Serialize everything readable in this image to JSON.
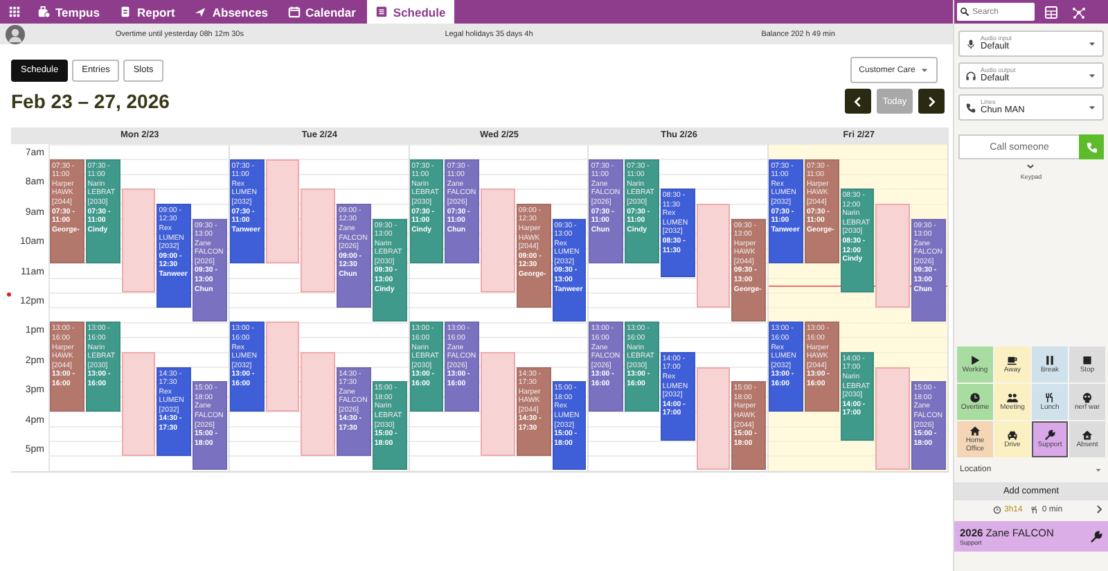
{
  "nav": {
    "tabs": [
      {
        "label": "Tempus",
        "kind": "bag",
        "selected": false
      },
      {
        "label": "Report",
        "kind": "report",
        "selected": false
      },
      {
        "label": "Absences",
        "kind": "plane",
        "selected": false
      },
      {
        "label": "Calendar",
        "kind": "calendar",
        "selected": false
      },
      {
        "label": "Schedule",
        "kind": "list",
        "selected": true
      }
    ]
  },
  "info_bar": [
    "Overtime until yesterday 08h 12m 30s",
    "Legal holidays 35 days 4h",
    "Balance 202 h 49 min"
  ],
  "view_tabs": [
    {
      "label": "Schedule",
      "selected": true
    },
    {
      "label": "Entries",
      "selected": false
    },
    {
      "label": "Slots",
      "selected": false
    }
  ],
  "team_select": {
    "value": "Customer Care"
  },
  "title": "Feb 23 – 27, 2026",
  "today_button": {
    "label": "Today",
    "disabled": true
  },
  "hours": [
    "7am",
    "8am",
    "9am",
    "10am",
    "11am",
    "12pm",
    "1pm",
    "2pm",
    "3pm",
    "4pm",
    "5pm"
  ],
  "days": [
    {
      "label": "Mon 2/23",
      "today": false,
      "events": [
        {
          "kind": "shift",
          "time": "07:30 - 11:00",
          "person": "Harper HAWK [2044]",
          "color": "#b3776c",
          "extra_time": "07:30 - 11:00",
          "extra_name": "George-"
        },
        {
          "kind": "shift",
          "time": "07:30 - 11:00",
          "person": "Narin LEBRAT [2030]",
          "color": "#3f9a8b",
          "extra_time": "07:30 - 11:00",
          "extra_name": "Cindy"
        },
        {
          "kind": "slot"
        },
        {
          "kind": "shift",
          "time": "09:00 - 12:30",
          "person": "Rex LUMEN [2032]",
          "color": "#3f5fd8",
          "extra_time": "09:00 - 12:30",
          "extra_name": "Tanweer"
        },
        {
          "kind": "shift",
          "time": "09:30 - 13:00",
          "person": "Zane FALCON [2026]",
          "color": "#7a72c0",
          "extra_time": "09:30 - 13:00",
          "extra_name": "Chun"
        },
        {
          "kind": "shift",
          "time": "13:00 - 16:00",
          "person": "Harper HAWK [2044]",
          "color": "#b3776c",
          "extra_time": "13:00 - 16:00"
        },
        {
          "kind": "shift",
          "time": "13:00 - 16:00",
          "person": "Narin LEBRAT [2030]",
          "color": "#3f9a8b",
          "extra_time": "13:00 - 16:00"
        },
        {
          "kind": "slot"
        },
        {
          "kind": "shift",
          "time": "14:30 - 17:30",
          "person": "Rex LUMEN [2032]",
          "color": "#3f5fd8",
          "extra_time": "14:30 - 17:30"
        },
        {
          "kind": "shift",
          "time": "15:00 - 18:00",
          "person": "Zane FALCON [2026]",
          "color": "#7a72c0",
          "extra_time": "15:00 - 18:00"
        }
      ]
    },
    {
      "label": "Tue 2/24",
      "today": false,
      "events": [
        {
          "kind": "shift",
          "time": "07:30 - 11:00",
          "person": "Rex LUMEN [2032]",
          "color": "#3f5fd8",
          "extra_time": "07:30 - 11:00",
          "extra_name": "Tanweer"
        },
        {
          "kind": "mirror_slot"
        },
        {
          "kind": "slot"
        },
        {
          "kind": "shift",
          "time": "09:00 - 12:30",
          "person": "Zane FALCON [2026]",
          "color": "#7a72c0",
          "extra_time": "09:00 - 12:30",
          "extra_name": "Chun"
        },
        {
          "kind": "shift",
          "time": "09:30 - 13:00",
          "person": "Narin LEBRAT [2030]",
          "color": "#3f9a8b",
          "extra_time": "09:30 - 13:00",
          "extra_name": "Cindy"
        },
        {
          "kind": "shift",
          "time": "13:00 - 16:00",
          "person": "Rex LUMEN [2032]",
          "color": "#3f5fd8",
          "extra_time": "13:00 - 16:00"
        },
        {
          "kind": "mirror_slot"
        },
        {
          "kind": "slot"
        },
        {
          "kind": "shift",
          "time": "14:30 - 17:30",
          "person": "Zane FALCON [2026]",
          "color": "#7a72c0",
          "extra_time": "14:30 - 17:30"
        },
        {
          "kind": "shift",
          "time": "15:00 - 18:00",
          "person": "Narin LEBRAT [2030]",
          "color": "#3f9a8b",
          "extra_time": "15:00 - 18:00"
        }
      ]
    },
    {
      "label": "Wed 2/25",
      "today": false,
      "events": [
        {
          "kind": "shift",
          "time": "07:30 - 11:00",
          "person": "Narin LEBRAT [2030]",
          "color": "#3f9a8b",
          "extra_time": "07:30 - 11:00",
          "extra_name": "Cindy"
        },
        {
          "kind": "shift",
          "time": "07:30 - 11:00",
          "person": "Zane FALCON [2026]",
          "color": "#7a72c0",
          "extra_time": "07:30 - 11:00",
          "extra_name": "Chun"
        },
        {
          "kind": "slot"
        },
        {
          "kind": "shift",
          "time": "09:00 - 12:30",
          "person": "Harper HAWK [2044]",
          "color": "#b3776c",
          "extra_time": "09:00 - 12:30",
          "extra_name": "George-"
        },
        {
          "kind": "shift",
          "time": "09:30 - 13:00",
          "person": "Rex LUMEN [2032]",
          "color": "#3f5fd8",
          "extra_time": "09:30 - 13:00",
          "extra_name": "Tanweer"
        },
        {
          "kind": "shift",
          "time": "13:00 - 16:00",
          "person": "Narin LEBRAT [2030]",
          "color": "#3f9a8b",
          "extra_time": "13:00 - 16:00"
        },
        {
          "kind": "shift",
          "time": "13:00 - 16:00",
          "person": "Zane FALCON [2026]",
          "color": "#7a72c0",
          "extra_time": "13:00 - 16:00"
        },
        {
          "kind": "slot"
        },
        {
          "kind": "shift",
          "time": "14:30 - 17:30",
          "person": "Harper HAWK [2044]",
          "color": "#b3776c",
          "extra_time": "14:30 - 17:30"
        },
        {
          "kind": "shift",
          "time": "15:00 - 18:00",
          "person": "Rex LUMEN [2032]",
          "color": "#3f5fd8",
          "extra_time": "15:00 - 18:00"
        }
      ]
    },
    {
      "label": "Thu 2/26",
      "today": false,
      "events": [
        {
          "kind": "shift",
          "time": "07:30 - 11:00",
          "person": "Zane FALCON [2026]",
          "color": "#7a72c0",
          "extra_time": "07:30 - 11:00",
          "extra_name": "Chun"
        },
        {
          "kind": "shift",
          "time": "07:30 - 11:00",
          "person": "Narin LEBRAT [2030]",
          "color": "#3f9a8b",
          "extra_time": "07:30 - 11:00",
          "extra_name": "Cindy"
        },
        {
          "kind": "shift",
          "time": "08:30 - 11:30",
          "person": "Rex LUMEN [2032]",
          "color": "#3f5fd8",
          "extra_time": "08:30 - 11:30"
        },
        {
          "kind": "slot"
        },
        {
          "kind": "shift",
          "time": "09:30 - 13:00",
          "person": "Harper HAWK [2044]",
          "color": "#b3776c",
          "extra_time": "09:30 - 13:00",
          "extra_name": "George-"
        },
        {
          "kind": "shift",
          "time": "13:00 - 16:00",
          "person": "Zane FALCON [2026]",
          "color": "#7a72c0",
          "extra_time": "13:00 - 16:00"
        },
        {
          "kind": "shift",
          "time": "13:00 - 16:00",
          "person": "Narin LEBRAT [2030]",
          "color": "#3f9a8b",
          "extra_time": "13:00 - 16:00"
        },
        {
          "kind": "shift",
          "time": "14:00 - 17:00",
          "person": "Rex LUMEN [2032]",
          "color": "#3f5fd8",
          "extra_time": "14:00 - 17:00"
        },
        {
          "kind": "slot"
        },
        {
          "kind": "shift",
          "time": "15:00 - 18:00",
          "person": "Harper HAWK [2044]",
          "color": "#b3776c",
          "extra_time": "15:00 - 18:00"
        }
      ]
    },
    {
      "label": "Fri 2/27",
      "today": true,
      "events": [
        {
          "kind": "shift",
          "time": "07:30 - 11:00",
          "person": "Rex LUMEN [2032]",
          "color": "#3f5fd8",
          "extra_time": "07:30 - 11:00",
          "extra_name": "Tanweer"
        },
        {
          "kind": "shift",
          "time": "07:30 - 11:00",
          "person": "Harper HAWK [2044]",
          "color": "#b3776c",
          "extra_time": "07:30 - 11:00",
          "extra_name": "George-"
        },
        {
          "kind": "shift",
          "time": "08:30 - 12:00",
          "person": "Narin LEBRAT [2030]",
          "color": "#3f9a8b",
          "extra_time": "08:30 - 12:00",
          "extra_name": "Cindy"
        },
        {
          "kind": "slot"
        },
        {
          "kind": "shift",
          "time": "09:30 - 13:00",
          "person": "Zane FALCON [2026]",
          "color": "#7a72c0",
          "extra_time": "09:30 - 13:00",
          "extra_name": "Chun"
        },
        {
          "kind": "shift",
          "time": "13:00 - 16:00",
          "person": "Rex LUMEN [2032]",
          "color": "#3f5fd8",
          "extra_time": "13:00 - 16:00"
        },
        {
          "kind": "shift",
          "time": "13:00 - 16:00",
          "person": "Harper HAWK [2044]",
          "color": "#b3776c",
          "extra_time": "13:00 - 16:00"
        },
        {
          "kind": "shift",
          "time": "14:00 - 17:00",
          "person": "Narin LEBRAT [2030]",
          "color": "#3f9a8b",
          "extra_time": "14:00 - 17:00"
        },
        {
          "kind": "slot"
        },
        {
          "kind": "shift",
          "time": "15:00 - 18:00",
          "person": "Zane FALCON [2026]",
          "color": "#7a72c0",
          "extra_time": "15:00 - 18:00"
        }
      ]
    }
  ],
  "sidebar": {
    "search": {
      "placeholder": "Search"
    },
    "audio_input": {
      "label": "Audio input",
      "value": "Default"
    },
    "audio_output": {
      "label": "Audio output",
      "value": "Default"
    },
    "lines": {
      "label": "Lines",
      "value": "Chun MAN"
    },
    "call": {
      "placeholder": "Call someone"
    },
    "keypad": "Keypad",
    "statuses": [
      {
        "label": "Working",
        "kind": "play",
        "color": "#a9dca1",
        "selected": false
      },
      {
        "label": "Away",
        "kind": "cup",
        "color": "#fbf0c2",
        "selected": false
      },
      {
        "label": "Break",
        "kind": "pause",
        "color": "#cfe2ec",
        "selected": false
      },
      {
        "label": "Stop",
        "kind": "stop",
        "color": "#dcdcdc",
        "selected": false
      },
      {
        "label": "Overtime",
        "kind": "clock",
        "color": "#a9dca1",
        "selected": false
      },
      {
        "label": "Meeting",
        "kind": "people",
        "color": "#fbf0c2",
        "selected": false
      },
      {
        "label": "Lunch",
        "kind": "cutlery",
        "color": "#cfe2ec",
        "selected": false
      },
      {
        "label": "nerf war",
        "kind": "robot",
        "color": "#dcdcdc",
        "selected": false
      },
      {
        "label": "Home Office",
        "kind": "house",
        "color": "#f4d6b6",
        "selected": false
      },
      {
        "label": "Drive",
        "kind": "car",
        "color": "#fbf0c2",
        "selected": false
      },
      {
        "label": "Support",
        "kind": "wrench",
        "color": "#d8a8e8",
        "selected": true
      },
      {
        "label": "Absent",
        "kind": "home",
        "color": "#dcdcdc",
        "selected": false
      }
    ],
    "location": {
      "placeholder": "Location"
    },
    "add_comment": "Add comment",
    "stats": {
      "worked": "3h14",
      "lunch": "0 min"
    },
    "current": {
      "id": "2026",
      "name": "Zane FALCON",
      "status": "Support"
    }
  }
}
